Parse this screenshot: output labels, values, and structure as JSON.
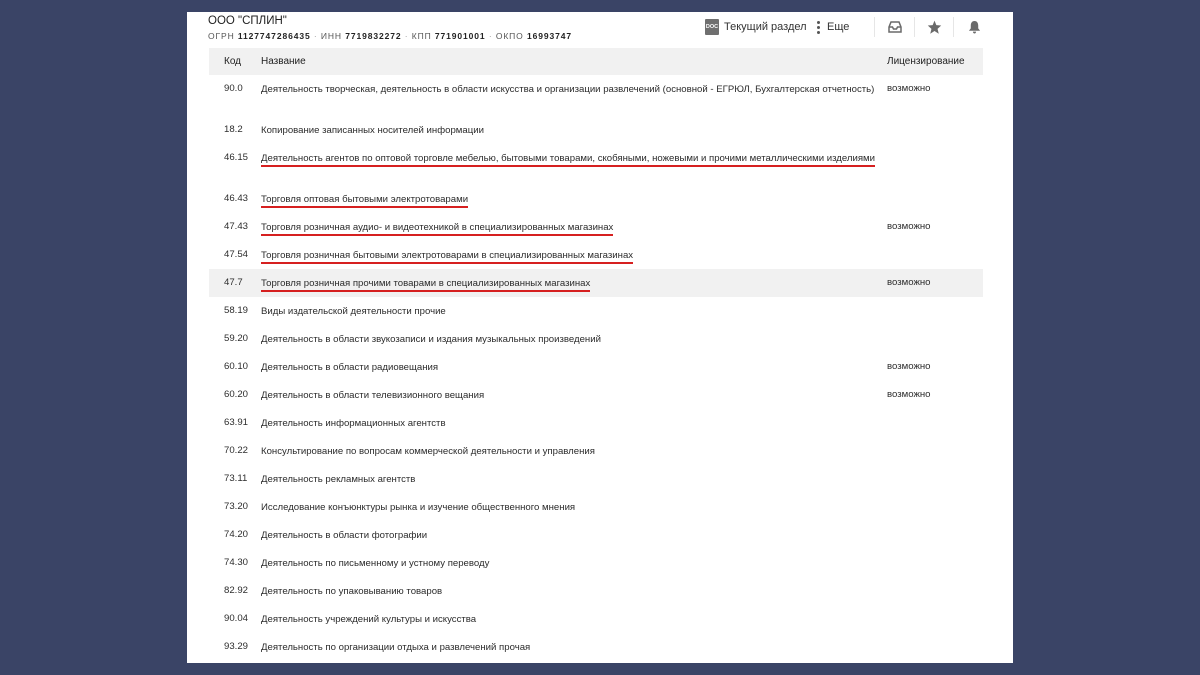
{
  "company": {
    "name": "ООО \"СПЛИН\"",
    "ogrn_label": "ОГРН",
    "ogrn": "1127747286435",
    "inn_label": "ИНН",
    "inn": "7719832272",
    "kpp_label": "КПП",
    "kpp": "771901001",
    "okpo_label": "ОКПО",
    "okpo": "16993747"
  },
  "toolbar": {
    "doc_icon_text": "DOC",
    "current_section_label": "Текущий раздел",
    "more_label": "Еще"
  },
  "table": {
    "headers": {
      "code": "Код",
      "name": "Название",
      "license": "Лицензирование"
    },
    "rows": [
      {
        "code": "90.0",
        "name": "Деятельность творческая, деятельность в области искусства и организации развлечений (основной - ЕГРЮЛ, Бухгалтерская отчетность)",
        "license": "возможно",
        "underlined": false,
        "highlighted": false
      },
      {
        "code": "18.2",
        "name": "Копирование записанных носителей информации",
        "license": "",
        "underlined": false,
        "highlighted": false
      },
      {
        "code": "46.15",
        "name": "Деятельность агентов по оптовой торговле мебелью, бытовыми товарами, скобяными, ножевыми и прочими металлическими изделиями",
        "license": "",
        "underlined": true,
        "highlighted": false
      },
      {
        "code": "46.43",
        "name": "Торговля оптовая бытовыми электротоварами",
        "license": "",
        "underlined": true,
        "highlighted": false
      },
      {
        "code": "47.43",
        "name": "Торговля розничная аудио- и видеотехникой в специализированных магазинах",
        "license": "возможно",
        "underlined": true,
        "highlighted": false
      },
      {
        "code": "47.54",
        "name": "Торговля розничная бытовыми электротоварами в специализированных магазинах",
        "license": "",
        "underlined": true,
        "highlighted": false
      },
      {
        "code": "47.7",
        "name": "Торговля розничная прочими товарами в специализированных магазинах",
        "license": "возможно",
        "underlined": true,
        "highlighted": true
      },
      {
        "code": "58.19",
        "name": "Виды издательской деятельности прочие",
        "license": "",
        "underlined": false,
        "highlighted": false
      },
      {
        "code": "59.20",
        "name": "Деятельность в области звукозаписи и издания музыкальных произведений",
        "license": "",
        "underlined": false,
        "highlighted": false
      },
      {
        "code": "60.10",
        "name": "Деятельность в области радиовещания",
        "license": "возможно",
        "underlined": false,
        "highlighted": false
      },
      {
        "code": "60.20",
        "name": "Деятельность в области телевизионного вещания",
        "license": "возможно",
        "underlined": false,
        "highlighted": false
      },
      {
        "code": "63.91",
        "name": "Деятельность информационных агентств",
        "license": "",
        "underlined": false,
        "highlighted": false
      },
      {
        "code": "70.22",
        "name": "Консультирование по вопросам коммерческой деятельности и управления",
        "license": "",
        "underlined": false,
        "highlighted": false
      },
      {
        "code": "73.11",
        "name": "Деятельность рекламных агентств",
        "license": "",
        "underlined": false,
        "highlighted": false
      },
      {
        "code": "73.20",
        "name": "Исследование конъюнктуры рынка и изучение общественного мнения",
        "license": "",
        "underlined": false,
        "highlighted": false
      },
      {
        "code": "74.20",
        "name": "Деятельность в области фотографии",
        "license": "",
        "underlined": false,
        "highlighted": false
      },
      {
        "code": "74.30",
        "name": "Деятельность по письменному и устному переводу",
        "license": "",
        "underlined": false,
        "highlighted": false
      },
      {
        "code": "82.92",
        "name": "Деятельность по упаковыванию товаров",
        "license": "",
        "underlined": false,
        "highlighted": false
      },
      {
        "code": "90.04",
        "name": "Деятельность учреждений культуры и искусства",
        "license": "",
        "underlined": false,
        "highlighted": false
      },
      {
        "code": "93.29",
        "name": "Деятельность по организации отдыха и развлечений прочая",
        "license": "",
        "underlined": false,
        "highlighted": false
      }
    ]
  },
  "colors": {
    "backdrop": "#3a4466",
    "underline": "#d62020",
    "header_bg": "#f1f1f1"
  },
  "icons": {
    "current_section": "doc-icon",
    "more": "more-dots-icon",
    "inbox": "inbox-icon",
    "favorite": "star-icon",
    "notifications": "bell-icon"
  }
}
